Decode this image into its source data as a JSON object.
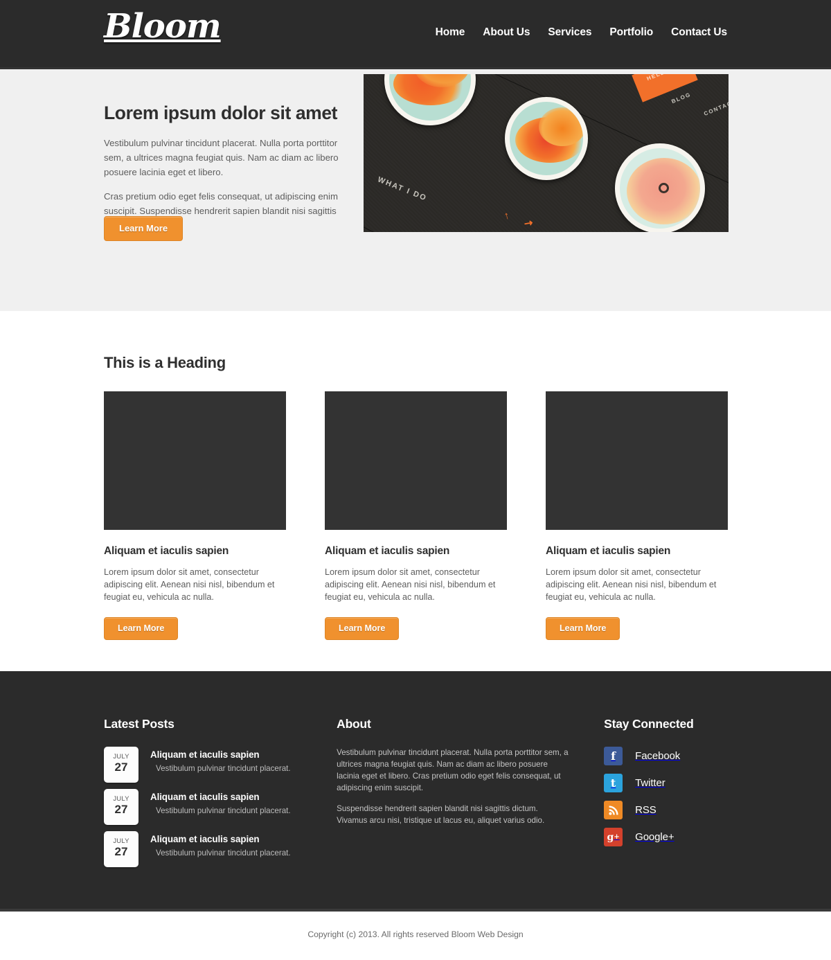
{
  "header": {
    "logo_text": "Bloom",
    "nav": [
      {
        "label": "Home",
        "name": "nav-home"
      },
      {
        "label": "About Us",
        "name": "nav-about-us"
      },
      {
        "label": "Services",
        "name": "nav-services"
      },
      {
        "label": "Portfolio",
        "name": "nav-portfolio"
      },
      {
        "label": "Contact Us",
        "name": "nav-contact-us"
      }
    ]
  },
  "hero": {
    "title": "Lorem ipsum dolor sit amet",
    "paragraph1": "Vestibulum pulvinar tincidunt placerat. Nulla porta porttitor sem, a ultrices magna feugiat quis. Nam ac diam ac libero posuere lacinia eget et libero.",
    "paragraph2": "Cras pretium odio eget felis consequat, ut adipiscing enim suscipit. Suspendisse hendrerit sapien blandit nisi sagittis dictum.",
    "button_label": "Learn More",
    "image_labels": {
      "what_i_do": "WHAT I DO",
      "blog": "BLOG",
      "contact": "CONTACT",
      "tag": "HELLO"
    }
  },
  "features": {
    "heading": "This is a Heading",
    "cards": [
      {
        "title": "Aliquam et iaculis sapien",
        "text": "Lorem ipsum dolor sit amet, consectetur adipiscing elit. Aenean nisi nisl, bibendum et feugiat eu, vehicula ac nulla.",
        "button_label": "Learn More"
      },
      {
        "title": "Aliquam et iaculis sapien",
        "text": "Lorem ipsum dolor sit amet, consectetur adipiscing elit. Aenean nisi nisl, bibendum et feugiat eu, vehicula ac nulla.",
        "button_label": "Learn More"
      },
      {
        "title": "Aliquam et iaculis sapien",
        "text": "Lorem ipsum dolor sit amet, consectetur adipiscing elit. Aenean nisi nisl, bibendum et feugiat eu, vehicula ac nulla.",
        "button_label": "Learn More"
      }
    ]
  },
  "footer": {
    "posts": {
      "title": "Latest Posts",
      "items": [
        {
          "month": "JULY",
          "day": "27",
          "title": "Aliquam et iaculis sapien",
          "excerpt": "Vestibulum pulvinar tincidunt placerat."
        },
        {
          "month": "JULY",
          "day": "27",
          "title": "Aliquam et iaculis sapien",
          "excerpt": "Vestibulum pulvinar tincidunt placerat."
        },
        {
          "month": "JULY",
          "day": "27",
          "title": "Aliquam et iaculis sapien",
          "excerpt": "Vestibulum pulvinar tincidunt placerat."
        }
      ]
    },
    "about": {
      "title": "About",
      "paragraph1": "Vestibulum pulvinar tincidunt placerat. Nulla porta porttitor sem, a ultrices magna feugiat quis. Nam ac diam ac libero posuere lacinia eget et libero. Cras pretium odio eget felis consequat, ut adipiscing enim suscipit.",
      "paragraph2": "Suspendisse hendrerit sapien blandit nisi sagittis dictum. Vivamus arcu nisi, tristique ut lacus eu, aliquet varius odio."
    },
    "social": {
      "title": "Stay Connected",
      "items": [
        {
          "label": "Facebook",
          "icon": "facebook-icon",
          "glyph": "f",
          "color": "#3c5a98"
        },
        {
          "label": "Twitter",
          "icon": "twitter-icon",
          "glyph": "t",
          "color": "#2ba3dd"
        },
        {
          "label": "RSS",
          "icon": "rss-icon",
          "glyph": "◔",
          "color": "#ef8a25"
        },
        {
          "label": "Google+",
          "icon": "google-plus-icon",
          "glyph": "g+",
          "color": "#d4412c"
        }
      ]
    }
  },
  "copyright": {
    "text": "Copyright (c) 2013. All rights reserved Bloom Web Design"
  }
}
